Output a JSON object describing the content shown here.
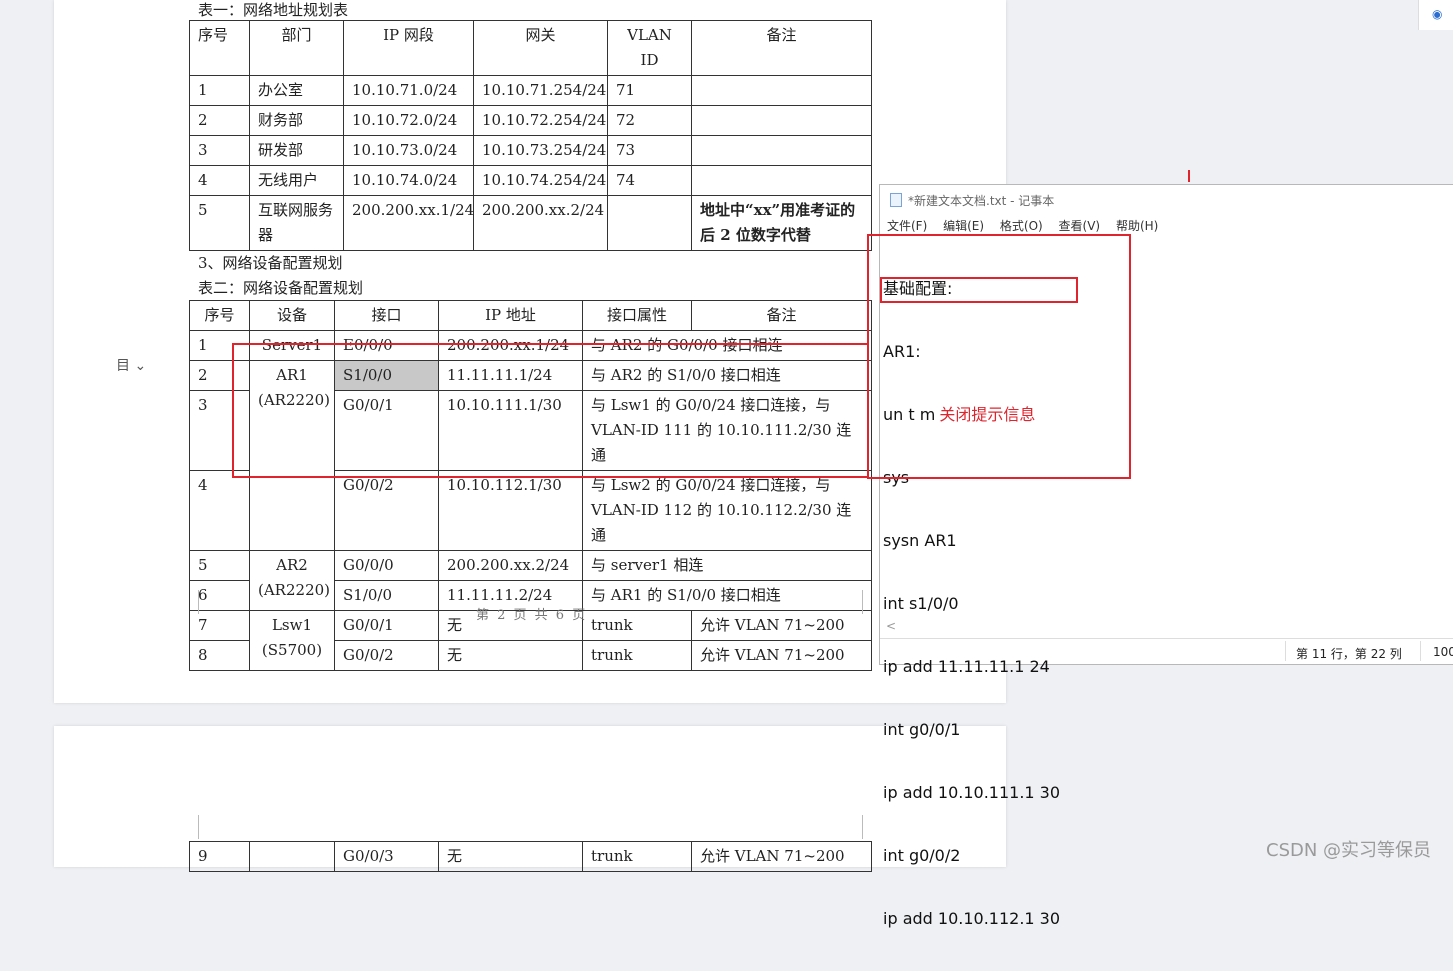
{
  "doc": {
    "table1_caption": "表一：网络地址规划表",
    "table1_header": [
      "序号",
      "部门",
      "IP 网段",
      "网关",
      "VLAN ID",
      "备注"
    ],
    "table1_rows": [
      [
        "1",
        "办公室",
        "10.10.71.0/24",
        "10.10.71.254/24",
        "71",
        ""
      ],
      [
        "2",
        "财务部",
        "10.10.72.0/24",
        "10.10.72.254/24",
        "72",
        ""
      ],
      [
        "3",
        "研发部",
        "10.10.73.0/24",
        "10.10.73.254/24",
        "73",
        ""
      ],
      [
        "4",
        "无线用户",
        "10.10.74.0/24",
        "10.10.74.254/24",
        "74",
        ""
      ],
      [
        "5",
        "互联网服务器",
        "200.200.xx.1/24",
        "200.200.xx.2/24",
        "",
        "地址中“xx”用准考证的后 2 位数字代替"
      ]
    ],
    "section3_heading": "3、网络设备配置规划",
    "table2_caption": "表二：网络设备配置规划",
    "table2_header": [
      "序号",
      "设备",
      "接口",
      "IP 地址",
      "接口属性",
      "备注"
    ],
    "table2": {
      "r1": [
        "1",
        "Server1",
        "E0/0/0",
        "200.200.xx.1/24",
        "与 AR2 的 G0/0/0 接口相连",
        ""
      ],
      "r2_num": "2",
      "ar1_name": "AR1",
      "ar1_model": "(AR2220)",
      "r2": [
        "S1/0/0",
        "11.11.11.1/24",
        "与 AR2 的 S1/0/0 接口相连"
      ],
      "r3_num": "3",
      "r3": [
        "G0/0/1",
        "10.10.111.1/30",
        "与 Lsw1 的 G0/0/24 接口连接，与 VLAN-ID 111 的 10.10.111.2/30 连通"
      ],
      "r4_num": "4",
      "r4": [
        "G0/0/2",
        "10.10.112.1/30",
        "与 Lsw2 的 G0/0/24 接口连接，与 VLAN-ID 112 的 10.10.112.2/30 连通"
      ],
      "r5_num": "5",
      "ar2_name": "AR2",
      "ar2_model": "(AR2220)",
      "r5": [
        "G0/0/0",
        "200.200.xx.2/24",
        "与 server1 相连"
      ],
      "r6_num": "6",
      "r6": [
        "S1/0/0",
        "11.11.11.2/24",
        "与 AR1 的 S1/0/0 接口相连"
      ],
      "r7_num": "7",
      "lsw1_name": "Lsw1",
      "lsw1_model": "(S5700)",
      "r7": [
        "G0/0/1",
        "无",
        "trunk",
        "允许 VLAN 71~200"
      ],
      "r8_num": "8",
      "r8": [
        "G0/0/2",
        "无",
        "trunk",
        "允许 VLAN 71~200"
      ],
      "r9": [
        "9",
        "",
        "G0/0/3",
        "无",
        "trunk",
        "允许 VLAN 71~200"
      ]
    },
    "footer": "第 2 页 共 6 页",
    "outline_icon": "list-icon"
  },
  "notepad": {
    "title": "*新建文本文档.txt - 记事本",
    "menu": [
      "文件(F)",
      "编辑(E)",
      "格式(O)",
      "查看(V)",
      "帮助(H)"
    ],
    "lines": [
      "基础配置:",
      "AR1:",
      "un t m",
      "sys",
      "sysn AR1",
      "int s1/0/0",
      "ip add 11.11.11.1 24",
      "int g0/0/1",
      "ip add 10.10.111.1 30",
      "int g0/0/2",
      "ip add 10.10.112.1 30"
    ],
    "hint": "关闭提示信息",
    "status_position": "第 11 行，第 22 列",
    "status_zoom": "100"
  },
  "watermark": "CSDN @实习等保员",
  "colors": {
    "highlight_red": "#e0242e",
    "cell_shade": "#c8c8c8"
  }
}
